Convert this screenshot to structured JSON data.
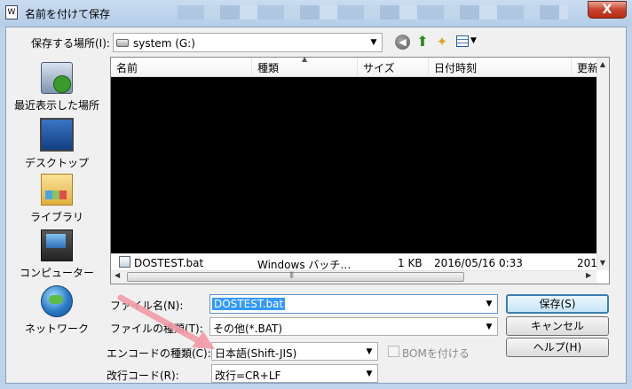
{
  "window": {
    "title": "名前を付けて保存",
    "title_icon": "W",
    "close_glyph": "X",
    "accent": "#3399ff"
  },
  "toolbar": {
    "location_label": "保存する場所(I):",
    "location_value": "system (G:)",
    "dropdown_glyph": "▼",
    "back_glyph": "◀",
    "up_glyph": "⬆",
    "newfolder_glyph": "✦",
    "view_glyph": "▾"
  },
  "places": [
    {
      "label": "最近表示した場所",
      "icon": "recent-places-icon"
    },
    {
      "label": "デスクトップ",
      "icon": "desktop-icon"
    },
    {
      "label": "ライブラリ",
      "icon": "library-icon"
    },
    {
      "label": "コンピューター",
      "icon": "computer-icon"
    },
    {
      "label": "ネットワーク",
      "icon": "network-icon"
    }
  ],
  "file_list": {
    "columns": [
      "名前",
      "種類",
      "サイズ",
      "日付時刻",
      "更新"
    ],
    "sort_glyph": "▲",
    "rows": [
      {
        "name": "DOSTEST.bat",
        "type": "Windows バッチ…",
        "size": "1 KB",
        "date": "2016/05/16 0:33",
        "extra": "201"
      }
    ],
    "scroll_up_glyph": "▲",
    "scroll_down_glyph": "▼",
    "scroll_left_glyph": "◀",
    "scroll_right_glyph": "▶",
    "grip_glyph": "|||"
  },
  "form": {
    "filename_label": "ファイル名(N):",
    "filename_value": "DOSTEST.bat",
    "filetype_label": "ファイルの種類(T):",
    "filetype_value": "その他(*.BAT)",
    "encoding_label": "エンコードの種類(C):",
    "encoding_value": "日本語(Shift-JIS)",
    "bom_label": "BOMを付ける",
    "newline_label": "改行コード(R):",
    "newline_value": "改行=CR+LF"
  },
  "buttons": {
    "save": "保存(S)",
    "cancel": "キャンセル",
    "help": "ヘルプ(H)"
  }
}
